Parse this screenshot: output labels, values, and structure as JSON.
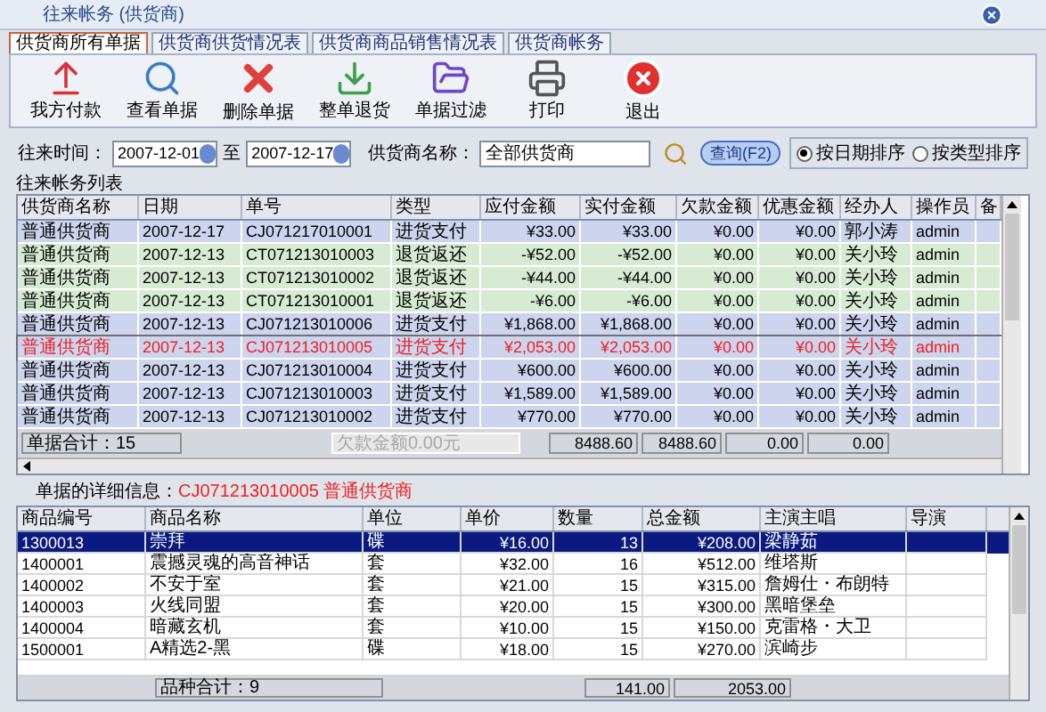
{
  "window": {
    "title": "往来帐务 (供货商)"
  },
  "tabs": [
    {
      "label": "供货商所有单据",
      "selected": true
    },
    {
      "label": "供货商供货情况表",
      "selected": false
    },
    {
      "label": "供货商商品销售情况表",
      "selected": false
    },
    {
      "label": "供货商帐务",
      "selected": false
    }
  ],
  "toolbar": [
    {
      "label": "我方付款",
      "kind": "pay"
    },
    {
      "label": "查看单据",
      "kind": "view"
    },
    {
      "label": "删除单据",
      "kind": "delete"
    },
    {
      "label": "整单退货",
      "kind": "return"
    },
    {
      "label": "单据过滤",
      "kind": "filter"
    },
    {
      "label": "打印",
      "kind": "print"
    },
    {
      "label": "退出",
      "kind": "exit"
    }
  ],
  "filter": {
    "time_label": "往来时间：",
    "from": "2007-12-01",
    "separator": "至",
    "to": "2007-12-17",
    "supplier_label": "供货商名称：",
    "supplier": "全部供货商",
    "query_button": "查询(F2)",
    "sort_options": [
      {
        "label": "按日期排序",
        "selected": true
      },
      {
        "label": "按类型排序",
        "selected": false
      }
    ]
  },
  "ledger": {
    "title": "往来帐务列表",
    "columns": [
      "供货商名称",
      "日期",
      "单号",
      "类型",
      "应付金额",
      "实付金额",
      "欠款金额",
      "优惠金额",
      "经办人",
      "操作员",
      "备"
    ],
    "rows": [
      {
        "kind": "payment",
        "selected": false,
        "cells": [
          "普通供货商",
          "2007-12-17",
          "CJ071217010001",
          "进货支付",
          "¥33.00",
          "¥33.00",
          "¥0.00",
          "¥0.00",
          "郭小涛",
          "admin",
          ""
        ]
      },
      {
        "kind": "return",
        "selected": false,
        "cells": [
          "普通供货商",
          "2007-12-13",
          "CT071213010003",
          "退货返还",
          "-¥52.00",
          "-¥52.00",
          "¥0.00",
          "¥0.00",
          "关小玲",
          "admin",
          ""
        ]
      },
      {
        "kind": "return",
        "selected": false,
        "cells": [
          "普通供货商",
          "2007-12-13",
          "CT071213010002",
          "退货返还",
          "-¥44.00",
          "-¥44.00",
          "¥0.00",
          "¥0.00",
          "关小玲",
          "admin",
          ""
        ]
      },
      {
        "kind": "return",
        "selected": false,
        "cells": [
          "普通供货商",
          "2007-12-13",
          "CT071213010001",
          "退货返还",
          "-¥6.00",
          "-¥6.00",
          "¥0.00",
          "¥0.00",
          "关小玲",
          "admin",
          ""
        ]
      },
      {
        "kind": "payment",
        "selected": false,
        "cells": [
          "普通供货商",
          "2007-12-13",
          "CJ071213010006",
          "进货支付",
          "¥1,868.00",
          "¥1,868.00",
          "¥0.00",
          "¥0.00",
          "关小玲",
          "admin",
          ""
        ]
      },
      {
        "kind": "payment",
        "selected": true,
        "cells": [
          "普通供货商",
          "2007-12-13",
          "CJ071213010005",
          "进货支付",
          "¥2,053.00",
          "¥2,053.00",
          "¥0.00",
          "¥0.00",
          "关小玲",
          "admin",
          ""
        ]
      },
      {
        "kind": "payment",
        "selected": false,
        "cells": [
          "普通供货商",
          "2007-12-13",
          "CJ071213010004",
          "进货支付",
          "¥600.00",
          "¥600.00",
          "¥0.00",
          "¥0.00",
          "关小玲",
          "admin",
          ""
        ]
      },
      {
        "kind": "payment",
        "selected": false,
        "cells": [
          "普通供货商",
          "2007-12-13",
          "CJ071213010003",
          "进货支付",
          "¥1,589.00",
          "¥1,589.00",
          "¥0.00",
          "¥0.00",
          "关小玲",
          "admin",
          ""
        ]
      },
      {
        "kind": "payment",
        "selected": false,
        "cells": [
          "普通供货商",
          "2007-12-13",
          "CJ071213010002",
          "进货支付",
          "¥770.00",
          "¥770.00",
          "¥0.00",
          "¥0.00",
          "关小玲",
          "admin",
          ""
        ]
      }
    ],
    "footer": {
      "count": "单据合计：15",
      "debt": "欠款金额0.00元",
      "totals": [
        "8488.60",
        "8488.60",
        "0.00",
        "0.00"
      ]
    }
  },
  "detail": {
    "label": "单据的详细信息：",
    "bill": "CJ071213010005 普通供货商",
    "columns": [
      "商品编号",
      "商品名称",
      "单位",
      "单价",
      "数量",
      "总金额",
      "主演主唱",
      "导演"
    ],
    "rows": [
      {
        "selected": true,
        "cells": [
          "1300013",
          "崇拜",
          "碟",
          "¥16.00",
          "13",
          "¥208.00",
          "梁静茹",
          ""
        ]
      },
      {
        "selected": false,
        "cells": [
          "1400001",
          "震撼灵魂的高音神话",
          "套",
          "¥32.00",
          "16",
          "¥512.00",
          "维塔斯",
          ""
        ]
      },
      {
        "selected": false,
        "cells": [
          "1400002",
          "不安于室",
          "套",
          "¥21.00",
          "15",
          "¥315.00",
          "詹姆仕・布朗特",
          ""
        ]
      },
      {
        "selected": false,
        "cells": [
          "1400003",
          "火线同盟",
          "套",
          "¥20.00",
          "15",
          "¥300.00",
          "黑暗堡垒",
          ""
        ]
      },
      {
        "selected": false,
        "cells": [
          "1400004",
          "暗藏玄机",
          "套",
          "¥10.00",
          "15",
          "¥150.00",
          "克雷格・大卫",
          ""
        ]
      },
      {
        "selected": false,
        "cells": [
          "1500001",
          "A精选2-黑",
          "碟",
          "¥18.00",
          "15",
          "¥270.00",
          "滨崎步",
          ""
        ]
      }
    ],
    "footer": {
      "count": "品种合计：9",
      "totals": [
        "141.00",
        "2053.00"
      ]
    }
  }
}
